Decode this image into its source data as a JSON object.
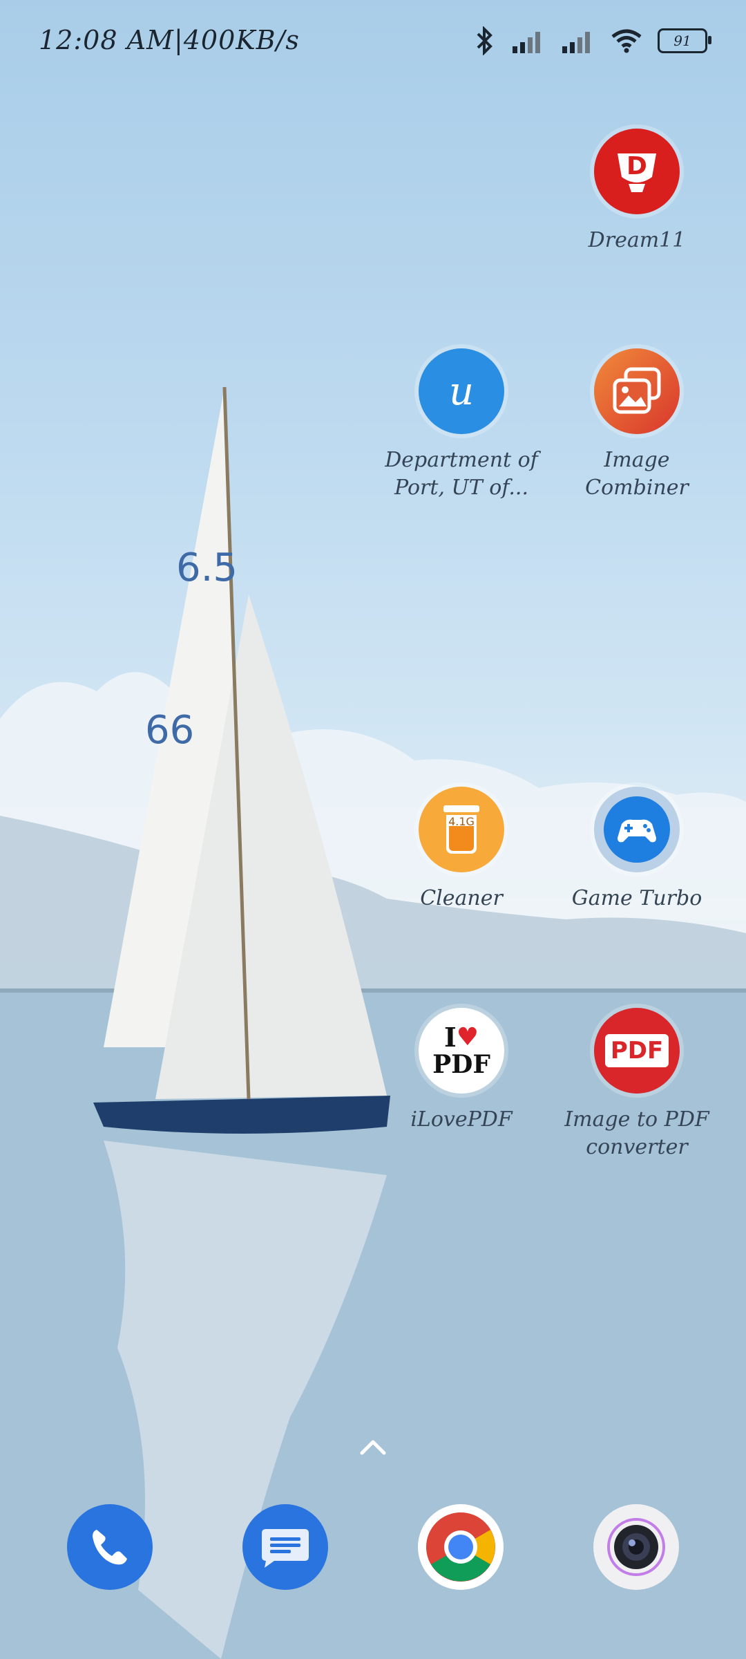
{
  "status_bar": {
    "time_and_speed": "12:08 AM|400KB/s",
    "battery": "91"
  },
  "apps": [
    {
      "id": "dream11",
      "label": "Dream11"
    },
    {
      "id": "department",
      "label": "Department of Port, UT of..."
    },
    {
      "id": "image-combiner",
      "label": "Image Combiner"
    },
    {
      "id": "cleaner",
      "label": "Cleaner",
      "badge": "4.1G"
    },
    {
      "id": "game-turbo",
      "label": "Game Turbo"
    },
    {
      "id": "ilovepdf",
      "label": "iLovePDF",
      "icon_text_top": "I",
      "icon_text_bottom": "PDF"
    },
    {
      "id": "image-to-pdf",
      "label": "Image to PDF converter",
      "icon_text": "PDF"
    }
  ],
  "dock": [
    {
      "id": "phone",
      "icon": "phone-icon"
    },
    {
      "id": "messages",
      "icon": "messages-icon"
    },
    {
      "id": "chrome",
      "icon": "chrome-icon"
    },
    {
      "id": "camera",
      "icon": "camera-icon"
    }
  ],
  "department_icon_letter": "u",
  "dream11_icon_letter": "D",
  "colors": {
    "dream11": "#d91e1e",
    "department": "#2a8ee3",
    "image_combiner": "#e8552d",
    "cleaner": "#f7a93a",
    "game_turbo": "#1e7fe0",
    "pdf_red": "#d8262a",
    "phone": "#2a74e0",
    "messages": "#2a74e0"
  }
}
